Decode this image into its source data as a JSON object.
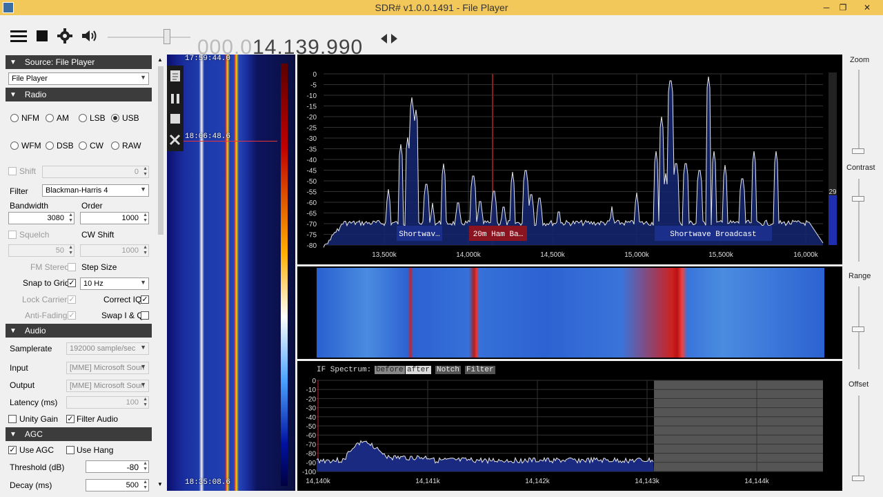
{
  "window": {
    "title": "SDR# v1.0.0.1491 - File Player",
    "min": "─",
    "max": "❐",
    "close": "✕"
  },
  "toolbar": {
    "menu_icon": "hamburger-icon",
    "stop_icon": "stop-icon",
    "settings_icon": "gear-icon",
    "audio_icon": "speaker-icon",
    "freq_dim": "000.0",
    "freq_main": "14.139.990"
  },
  "source": {
    "header": "Source: File Player",
    "selected": "File Player"
  },
  "radio": {
    "header": "Radio",
    "modes": [
      "NFM",
      "AM",
      "LSB",
      "USB",
      "WFM",
      "DSB",
      "CW",
      "RAW"
    ],
    "selected_mode": "USB",
    "shift_label": "Shift",
    "shift_value": "0",
    "filter_label": "Filter",
    "filter_value": "Blackman-Harris 4",
    "bandwidth_label": "Bandwidth",
    "bandwidth_value": "3080",
    "order_label": "Order",
    "order_value": "1000",
    "squelch_label": "Squelch",
    "squelch_value": "50",
    "cwshift_label": "CW Shift",
    "cwshift_value": "1000",
    "fmstereo_label": "FM Stereo",
    "stepsize_label": "Step Size",
    "snap_label": "Snap to Grid",
    "snap_value": "10 Hz",
    "lockcarrier_label": "Lock Carrier",
    "correctiq_label": "Correct IQ",
    "antifading_label": "Anti-Fading",
    "swapiq_label": "Swap I & Q"
  },
  "audio": {
    "header": "Audio",
    "samplerate_label": "Samplerate",
    "samplerate_value": "192000 sample/sec",
    "input_label": "Input",
    "input_value": "[MME] Microsoft Soun",
    "output_label": "Output",
    "output_value": "[MME] Microsoft Soun",
    "latency_label": "Latency (ms)",
    "latency_value": "100",
    "unitygain_label": "Unity Gain",
    "filteraudio_label": "Filter Audio"
  },
  "agc": {
    "header": "AGC",
    "useagc_label": "Use AGC",
    "usehang_label": "Use Hang",
    "threshold_label": "Threshold (dB)",
    "threshold_value": "-80",
    "decay_label": "Decay (ms)",
    "decay_value": "500"
  },
  "waterfall_side": {
    "timestamps": [
      "17:59:44.0",
      "18:06:48.6",
      "18:35:08.6"
    ]
  },
  "spectrum": {
    "db_ticks": [
      "0",
      "-5",
      "-10",
      "-15",
      "-20",
      "-25",
      "-30",
      "-35",
      "-40",
      "-45",
      "-50",
      "-55",
      "-60",
      "-65",
      "-70",
      "-75",
      "-80"
    ],
    "freq_ticks": [
      "13,500k",
      "14,000k",
      "14,500k",
      "15,000k",
      "15,500k",
      "16,000k"
    ],
    "bands": [
      "Shortwav…",
      "20m Ham Ba…",
      "Shortwave Broadcast"
    ],
    "level_readout": "29"
  },
  "if_spectrum": {
    "label": "IF Spectrum:",
    "buttons": [
      "before",
      "after",
      "Notch",
      "Filter"
    ],
    "db_ticks": [
      "0",
      "-10",
      "-20",
      "-30",
      "-40",
      "-50",
      "-60",
      "-70",
      "-80",
      "-90",
      "-100"
    ],
    "freq_ticks": [
      "14,140k",
      "14,141k",
      "14,142k",
      "14,143k",
      "14,144k"
    ]
  },
  "right": {
    "zoom": "Zoom",
    "contrast": "Contrast",
    "range": "Range",
    "offset": "Offset"
  }
}
